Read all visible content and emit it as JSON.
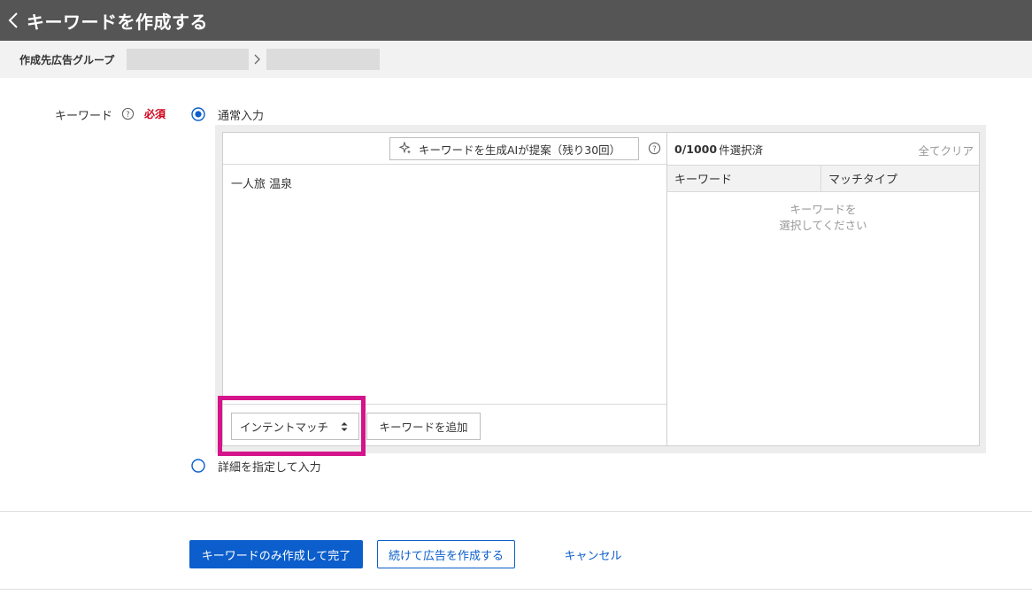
{
  "header": {
    "title": "キーワードを作成する"
  },
  "breadcrumb": {
    "label": "作成先広告グループ"
  },
  "form": {
    "field_label": "キーワード",
    "required_label": "必須",
    "options": [
      {
        "label": "通常入力",
        "selected": true
      },
      {
        "label": "詳細を指定して入力",
        "selected": false
      }
    ]
  },
  "editor": {
    "ai_suggest_label": "キーワードを生成AIが提案（残り30回）",
    "keyword_text": "一人旅 温泉",
    "match_type_value": "インテントマッチ",
    "add_keyword_label": "キーワードを追加"
  },
  "selection": {
    "count": "0/1000",
    "count_suffix": "件選択済",
    "clear_all_label": "全てクリア",
    "columns": [
      "キーワード",
      "マッチタイプ"
    ],
    "empty_line1": "キーワードを",
    "empty_line2": "選択してください"
  },
  "actions": {
    "primary_label": "キーワードのみ作成して完了",
    "secondary_label": "続けて広告を作成する",
    "cancel_label": "キャンセル"
  },
  "colors": {
    "header_bg": "#555555",
    "primary": "#0b5ecb",
    "required": "#d0021b",
    "highlight": "#d4148a"
  }
}
